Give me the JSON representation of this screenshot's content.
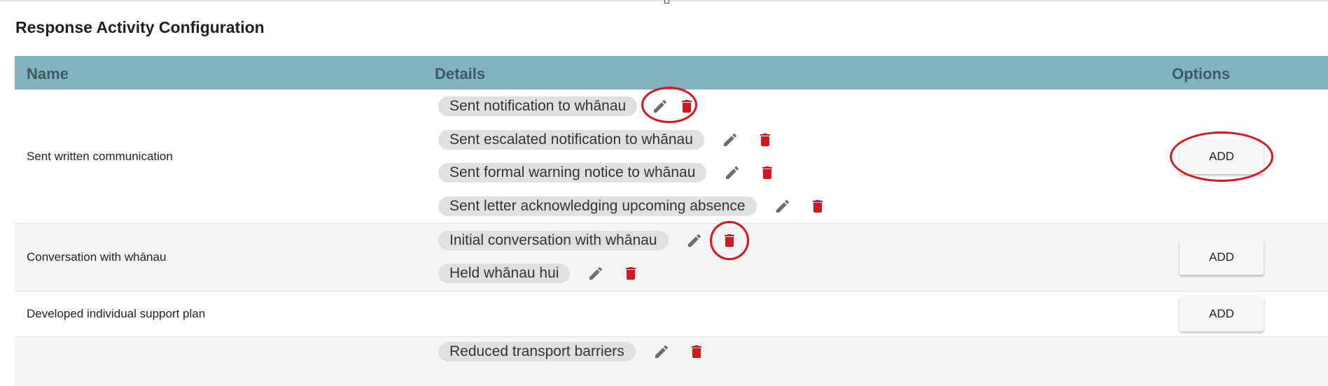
{
  "page": {
    "title": "Response Activity Configuration"
  },
  "table": {
    "headers": {
      "name": "Name",
      "details": "Details",
      "options": "Options"
    },
    "rows": [
      {
        "name": "Sent written communication",
        "add_label": "ADD",
        "details": [
          "Sent notification to whānau",
          "Sent escalated notification to whānau",
          "Sent formal warning notice to whānau",
          "Sent letter acknowledging upcoming absence"
        ]
      },
      {
        "name": "Conversation with whānau",
        "add_label": "ADD",
        "details": [
          "Initial conversation with whānau",
          "Held whānau hui"
        ]
      },
      {
        "name": "Developed individual support plan",
        "add_label": "ADD",
        "details": []
      },
      {
        "name": "",
        "add_label": "",
        "details": [
          "Reduced transport barriers"
        ]
      }
    ]
  },
  "icons": {
    "edit": "pencil-icon",
    "delete": "trash-icon"
  },
  "colors": {
    "header_bg": "#82b4c0",
    "header_text": "#3f5a61",
    "chip_bg": "#e0e0e0",
    "delete_red": "#d0191f",
    "edit_gray": "#6e6e6e",
    "annotation_red": "#e0121a",
    "alt_row_bg": "#f4f4f4"
  }
}
